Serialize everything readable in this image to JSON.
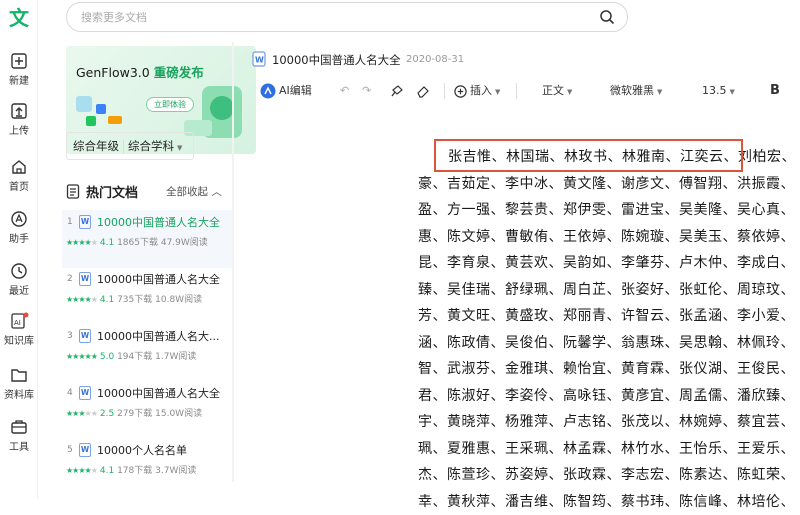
{
  "rail": {
    "logo": "文",
    "items": [
      {
        "label": "新建",
        "icon": "plus-square-icon"
      },
      {
        "label": "上传",
        "icon": "upload-icon"
      },
      {
        "label": "首页",
        "icon": "home-icon"
      },
      {
        "label": "助手",
        "icon": "assistant-icon"
      },
      {
        "label": "最近",
        "icon": "clock-icon"
      },
      {
        "label": "知识库",
        "icon": "ai-knowledge-icon"
      },
      {
        "label": "资料库",
        "icon": "folder-icon"
      },
      {
        "label": "工具",
        "icon": "toolbox-icon"
      }
    ]
  },
  "search": {
    "placeholder": "搜索更多文档"
  },
  "banner": {
    "title_a": "GenFlow3.0 ",
    "title_b": "重磅发布",
    "button": "立即体验"
  },
  "filter": {
    "grade": "综合年级",
    "subject": "综合学科"
  },
  "hot": {
    "title": "热门文档",
    "collapse": "全部收起"
  },
  "docs": [
    {
      "num": "1",
      "title": "10000中国普通人名大全",
      "stars": 4,
      "rating": "4.1",
      "downloads": "1865下载",
      "reads": "47.9W阅读",
      "active": true
    },
    {
      "num": "2",
      "title": "10000中国普通人名大全",
      "stars": 4,
      "rating": "4.1",
      "downloads": "735下载",
      "reads": "10.8W阅读",
      "active": false
    },
    {
      "num": "3",
      "title": "10000中国普通人名大...",
      "stars": 5,
      "rating": "5.0",
      "downloads": "194下载",
      "reads": "1.7W阅读",
      "active": false
    },
    {
      "num": "4",
      "title": "10000中国普通人名大全",
      "stars": 3,
      "rating": "2.5",
      "downloads": "279下载",
      "reads": "15.0W阅读",
      "active": false
    },
    {
      "num": "5",
      "title": "10000个人名名单",
      "stars": 4,
      "rating": "4.1",
      "downloads": "178下载",
      "reads": "3.7W阅读",
      "active": false
    }
  ],
  "document": {
    "title": "10000中国普通人名大全",
    "date": "2020-08-31",
    "toolbar": {
      "ai_edit": "AI编辑",
      "insert": "插入",
      "style": "正文",
      "font": "微软雅黑",
      "size": "13.5",
      "bold": "B"
    },
    "lines": [
      "张吉惟、林国瑞、林玫书、林雅南、江奕云、刘柏宏、",
      "豪、吉茹定、李中冰、黄文隆、谢彦文、傅智翔、洪振霞、",
      "盈、方一强、黎芸贵、郑伊雯、雷进宝、吴美隆、吴心真、",
      "惠、陈文婷、曹敏侑、王依婷、陈婉璇、吴美玉、蔡依婷、",
      "昆、李育泉、黄芸欢、吴韵如、李肇芬、卢木仲、李成白、",
      "臻、吴佳瑞、舒绿珮、周白芷、张姿好、张虹伦、周琼玟、",
      "芳、黄文旺、黄盛玫、郑丽青、许智云、张孟涵、李小爱、",
      "涵、陈政倩、吴俊伯、阮馨学、翁惠珠、吴思翰、林佩玲、",
      "智、武淑芬、金雅琪、赖怡宜、黄育霖、张仪湖、王俊民、",
      "君、陈淑好、李姿伶、高咏钰、黄彦宜、周孟儒、潘欣臻、",
      "宇、黄晓萍、杨雅萍、卢志铭、张茂以、林婉婷、蔡宜芸、",
      "珮、夏雅惠、王采珮、林孟霖、林竹水、王怡乐、王爱乐、",
      "杰、陈萱珍、苏姿婷、张政霖、李志宏、陈素达、陈虹荣、",
      "幸、黄秋萍、潘吉维、陈智筠、蔡书玮、陈信峰、林培伦、"
    ]
  },
  "colors": {
    "brand": "#17a35f",
    "highlight_box": "#d9553b"
  }
}
